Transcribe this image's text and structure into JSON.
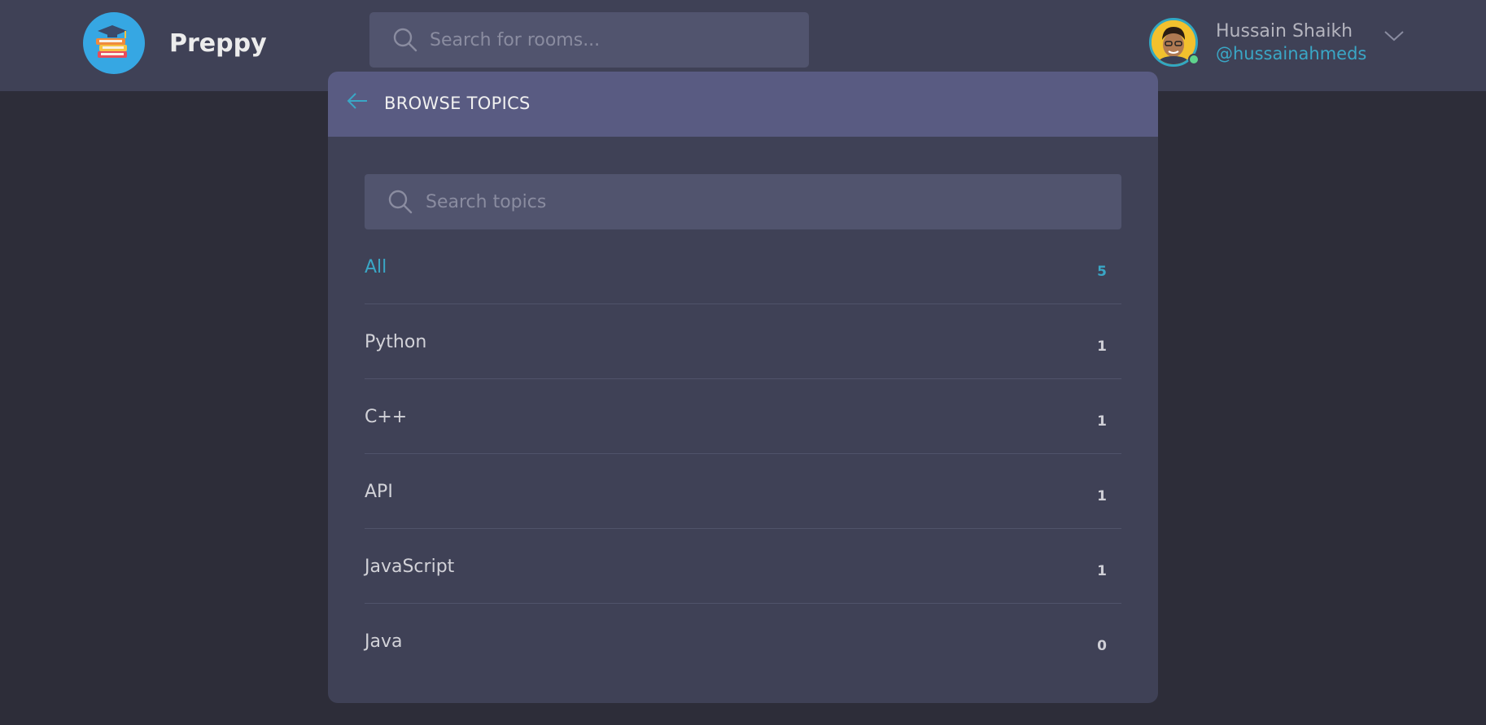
{
  "header": {
    "brand": "Preppy",
    "room_search_placeholder": "Search for rooms...",
    "user": {
      "name": "Hussain Shaikh",
      "handle": "@hussainahmeds",
      "status": "online"
    }
  },
  "modal": {
    "title": "BROWSE TOPICS",
    "search_placeholder": "Search topics",
    "topics": [
      {
        "name": "All",
        "count": "5",
        "active": true
      },
      {
        "name": "Python",
        "count": "1",
        "active": false
      },
      {
        "name": "C++",
        "count": "1",
        "active": false
      },
      {
        "name": "API",
        "count": "1",
        "active": false
      },
      {
        "name": "JavaScript",
        "count": "1",
        "active": false
      },
      {
        "name": "Java",
        "count": "0",
        "active": false
      }
    ]
  },
  "colors": {
    "page_bg": "#2d2d39",
    "header_bg": "#3f4156",
    "modal_header_bg": "#595b82",
    "accent": "#3aa7c6",
    "online": "#5fd38d"
  },
  "icons": [
    "logo-icon",
    "search-icon",
    "avatar",
    "chevron-down-icon",
    "arrow-left-icon"
  ]
}
